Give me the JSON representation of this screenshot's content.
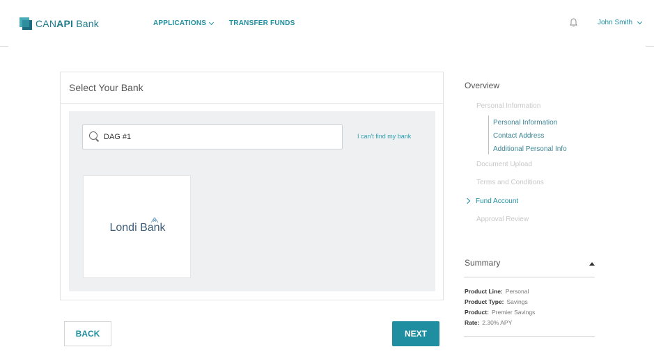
{
  "header": {
    "logo_prefix": "CAN",
    "logo_bold": "API",
    "logo_suffix": " Bank",
    "nav_applications": "APPLICATIONS",
    "nav_transfer": "TRANSFER FUNDS",
    "user_name": "John Smith"
  },
  "main": {
    "title": "Select Your Bank",
    "search_value": "DAG #1",
    "cant_find_link": "I can't find my bank",
    "bank_results": [
      {
        "name": "Londi Bank"
      }
    ],
    "back_label": "BACK",
    "next_label": "NEXT"
  },
  "overview": {
    "title": "Overview",
    "steps": {
      "personal": "Personal Information",
      "sub_personal": "Personal Information",
      "sub_contact": "Contact Address",
      "sub_additional": "Additional Personal Info",
      "document": "Document Upload",
      "terms": "Terms and Conditions",
      "fund": "Fund Account",
      "approval": "Approval Review"
    }
  },
  "summary": {
    "title": "Summary",
    "rows": [
      {
        "label": "Product Line:",
        "value": "Personal"
      },
      {
        "label": "Product Type:",
        "value": "Savings"
      },
      {
        "label": "Product:",
        "value": "Premier Savings"
      },
      {
        "label": "Rate:",
        "value": "2.30% APY"
      }
    ]
  },
  "colors": {
    "accent": "#1f8ea0",
    "panel_bg": "#eef0f2",
    "muted_step": "#c9c9c9"
  },
  "icons": [
    "logo-mark-icon",
    "chevron-down-icon",
    "bell-icon",
    "search-icon",
    "chevron-right-icon",
    "caret-up-icon"
  ]
}
